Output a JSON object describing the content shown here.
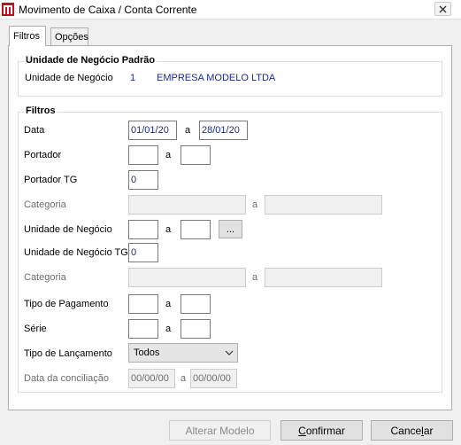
{
  "window": {
    "title": "Movimento de Caixa / Conta Corrente",
    "colors": {
      "value_text": "#1a2b8c",
      "app_icon": "#c0121e"
    }
  },
  "tabs": [
    {
      "label": "Filtros",
      "active": true
    },
    {
      "label": "Opções",
      "active": false
    }
  ],
  "default_unit": {
    "group_title": "Unidade de Negócio Padrão",
    "label": "Unidade de Negócio",
    "code": "1",
    "name": "EMPRESA MODELO LTDA"
  },
  "filters": {
    "group_title": "Filtros",
    "sep": "a",
    "data": {
      "label": "Data",
      "from": "01/01/20",
      "to": "28/01/20"
    },
    "portador": {
      "label": "Portador",
      "from": "",
      "to": ""
    },
    "portador_tg": {
      "label": "Portador TG",
      "value": "0"
    },
    "categoria1": {
      "label": "Categoria",
      "from": "",
      "to": ""
    },
    "unidade": {
      "label": "Unidade de Negócio",
      "from": "",
      "to": "",
      "browse": "..."
    },
    "unidade_tg": {
      "label": "Unidade de Negócio TG",
      "value": "0"
    },
    "categoria2": {
      "label": "Categoria",
      "from": "",
      "to": ""
    },
    "tipo_pagamento": {
      "label": "Tipo de Pagamento",
      "from": "",
      "to": ""
    },
    "serie": {
      "label": "Série",
      "from": "",
      "to": ""
    },
    "tipo_lancamento": {
      "label": "Tipo de Lançamento",
      "selected": "Todos"
    },
    "data_conciliacao": {
      "label": "Data da conciliação",
      "from": "00/00/00",
      "to": "00/00/00"
    }
  },
  "buttons": {
    "alterar": "Alterar Modelo",
    "confirmar_pre": "",
    "confirmar_u": "C",
    "confirmar_post": "onfirmar",
    "cancelar_pre": "Cance",
    "cancelar_u": "l",
    "cancelar_post": "ar"
  }
}
